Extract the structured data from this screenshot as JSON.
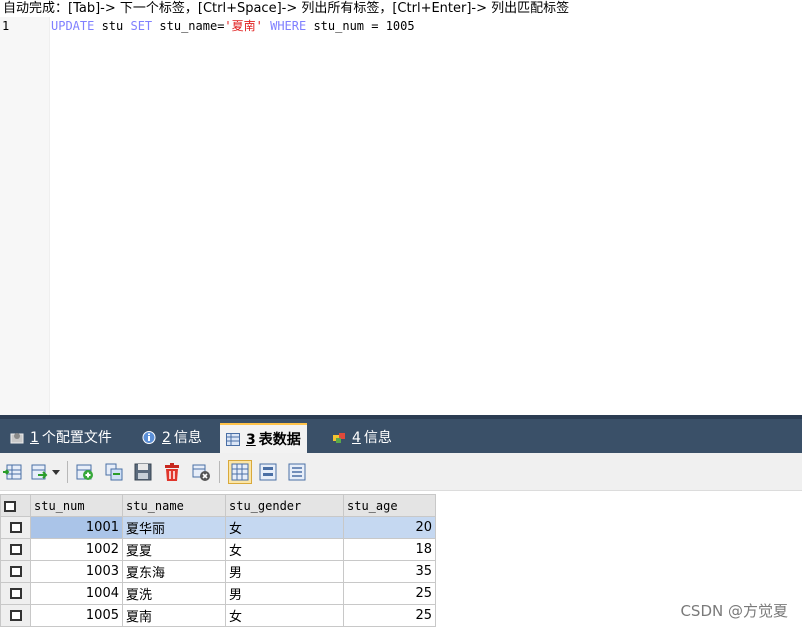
{
  "hint": "自动完成：[Tab]-> 下一个标签，[Ctrl+Space]-> 列出所有标签，[Ctrl+Enter]-> 列出匹配标签",
  "editor": {
    "line_number": "1",
    "code": {
      "kw_update": "UPDATE",
      "table": " stu ",
      "kw_set": "SET",
      "assign": " stu_name=",
      "value": "'夏南'",
      "kw_where": " WHERE",
      "cond": " stu_num = 1005"
    }
  },
  "tabs": [
    {
      "num": "1",
      "label": "个配置文件",
      "icon": "config-icon"
    },
    {
      "num": "2",
      "label": "信息",
      "icon": "info-icon"
    },
    {
      "num": "3",
      "label": "表数据",
      "icon": "table-icon",
      "active": true
    },
    {
      "num": "4",
      "label": "信息",
      "icon": "info-color-icon"
    }
  ],
  "grid": {
    "columns": [
      "stu_num",
      "stu_name",
      "stu_gender",
      "stu_age"
    ],
    "rows": [
      [
        "1001",
        "夏华丽",
        "女",
        "20"
      ],
      [
        "1002",
        "夏夏",
        "女",
        "18"
      ],
      [
        "1003",
        "夏东海",
        "男",
        "35"
      ],
      [
        "1004",
        "夏洗",
        "男",
        "25"
      ],
      [
        "1005",
        "夏南",
        "女",
        "25"
      ]
    ]
  },
  "watermark": "CSDN @方觉夏",
  "colors": {
    "keyword": "#8080ff",
    "string": "#e02020",
    "tab_strip": "#3a5068",
    "selected_row": "#c5d8f1"
  }
}
